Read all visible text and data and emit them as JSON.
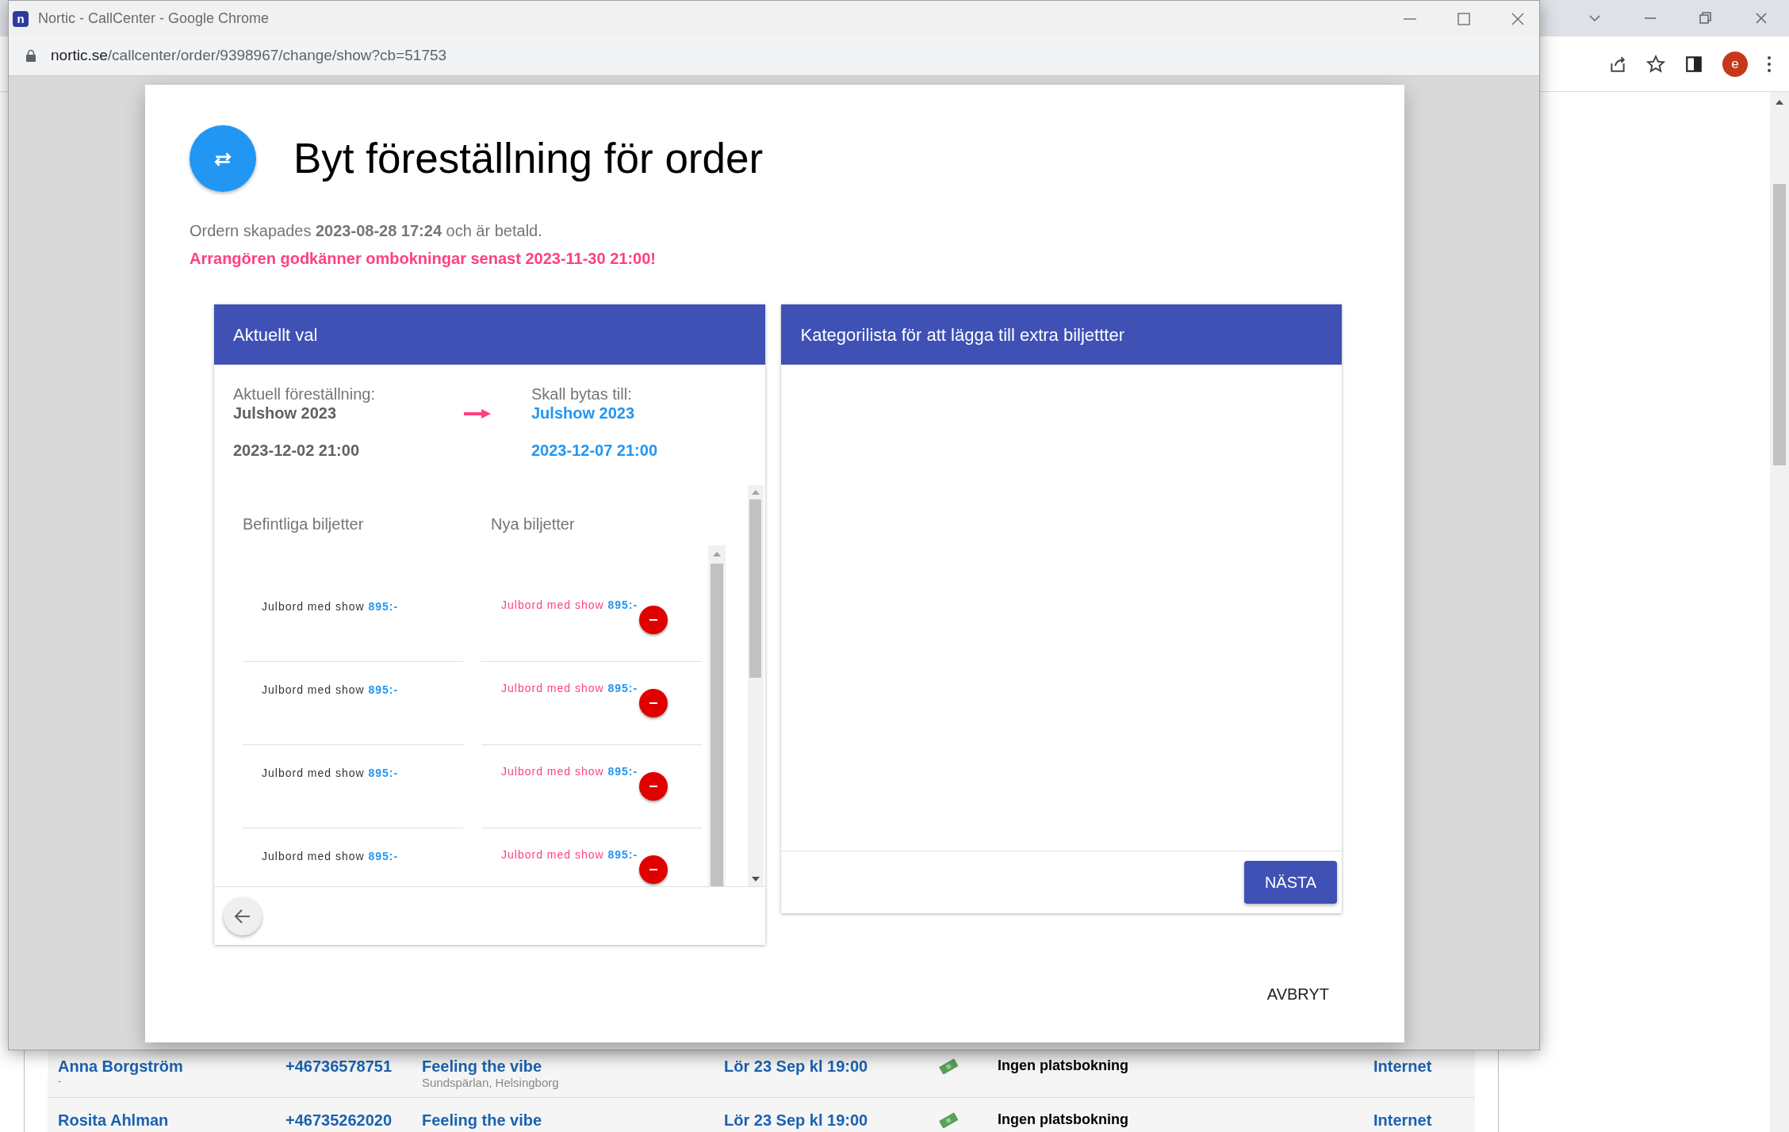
{
  "background_window": {
    "avatar_letter": "e",
    "rows": [
      {
        "name": "Anna Borgström",
        "note": "-",
        "phone": "+46736578751",
        "event": "Feeling the vibe",
        "venue": "Sundspärlan, Helsingborg",
        "date": "Lör 23 Sep kl 19:00",
        "seating": "Ingen platsbokning",
        "channel": "Internet"
      },
      {
        "name": "Rosita Ahlman",
        "phone": "+46735262020",
        "event": "Feeling the vibe",
        "date": "Lör 23 Sep kl 19:00",
        "seating": "Ingen platsbokning",
        "channel": "Internet"
      }
    ]
  },
  "popup_window": {
    "logo_letter": "n",
    "title": "Nortic - CallCenter - Google Chrome",
    "url_host": "nortic.se",
    "url_path": "/callcenter/order/9398967/change/show?cb=51753"
  },
  "dialog": {
    "title": "Byt föreställning för order",
    "info": "Ordern skapades **2023-08-28 17:24** och är betald.",
    "warning": "Arrangören godkänner ombokningar senast 2023-11-30 21:00!",
    "current_card": {
      "header": "Aktuellt val",
      "current_label": "Aktuell föreställning:",
      "current_show": "Julshow 2023",
      "current_date": "2023-12-02 21:00",
      "new_label": "Skall bytas till:",
      "new_show": "Julshow 2023",
      "new_date": "2023-12-07 21:00",
      "existing_heading": "Befintliga biljetter",
      "new_heading": "Nya biljetter",
      "existing_tickets": [
        {
          "name": "Julbord med show",
          "price": "895:-"
        },
        {
          "name": "Julbord med show",
          "price": "895:-"
        },
        {
          "name": "Julbord med show",
          "price": "895:-"
        },
        {
          "name": "Julbord med show",
          "price": "895:-"
        }
      ],
      "new_tickets": [
        {
          "name": "Julbord med show",
          "price": "895:-"
        },
        {
          "name": "Julbord med show",
          "price": "895:-"
        },
        {
          "name": "Julbord med show",
          "price": "895:-"
        },
        {
          "name": "Julbord med show",
          "price": "895:-"
        }
      ]
    },
    "category_card": {
      "header": "Kategorilista för att lägga till extra biljettter",
      "next_button": "NÄSTA"
    },
    "cancel_button": "AVBRYT"
  }
}
